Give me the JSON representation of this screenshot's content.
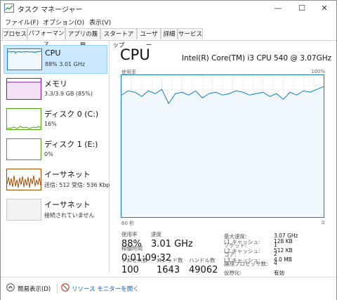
{
  "window": {
    "title": "タスク マネージャー",
    "minimize": "—",
    "maximize": "☐",
    "close": "✕"
  },
  "menu": [
    "ファイル(F)",
    "オプション(O)",
    "表示(V)"
  ],
  "tabs": [
    "プロセス",
    "パフォーマンス",
    "アプリの履歴",
    "スタートアップ",
    "ユーザー",
    "詳細",
    "サービス"
  ],
  "active_tab": 1,
  "resources": [
    {
      "name": "CPU",
      "detail": "88% 3.01 GHz",
      "color": "#117dbb",
      "level": 0.88
    },
    {
      "name": "メモリ",
      "detail": "3.3/3.9 GB (85%)",
      "color": "#8b12ae",
      "level": 0.85
    },
    {
      "name": "ディスク 0 (C:)",
      "detail": "16%",
      "color": "#4da60c",
      "level": 0.16
    },
    {
      "name": "ディスク 1 (E:)",
      "detail": "0%",
      "color": "#4da60c",
      "level": 0.0
    },
    {
      "name": "イーサネット",
      "detail": "送信: 512 受信: 536 Kbp",
      "color": "#a74f01",
      "level": 0.5
    },
    {
      "name": "イーサネット",
      "detail": "接続されていません",
      "color": "#a0a0a0",
      "level": 0.0
    }
  ],
  "cpu": {
    "title": "CPU",
    "model": "Intel(R) Core(TM) i3 CPU 540 @ 3.07GHz",
    "graph_label": "使用率",
    "graph_max": "100%",
    "time_left": "60 秒",
    "time_right": "0",
    "stats": {
      "usage_label": "使用率",
      "usage_value": "88%",
      "speed_label": "速度",
      "speed_value": "3.01 GHz",
      "process_label": "プロセス数",
      "process_value": "100",
      "thread_label": "スレッド数",
      "thread_value": "1643",
      "handle_label": "ハンドル数",
      "handle_value": "49062",
      "uptime_label": "稼働時間",
      "uptime_value": "0:01:09:32"
    },
    "specs": [
      {
        "label": "最大速度:",
        "value": "3.07 GHz"
      },
      {
        "label": "ソケット:",
        "value": "1"
      },
      {
        "label": "コア:",
        "value": "2"
      },
      {
        "label": "論理プロセッサ数:",
        "value": "4"
      },
      {
        "label": "仮想化:",
        "value": "有効"
      },
      {
        "label": "L1 キャッシュ:",
        "value": "128 KB"
      },
      {
        "label": "L2 キャッシュ:",
        "value": "512 KB"
      },
      {
        "label": "L3 キャッシュ:",
        "value": "4.0 MB"
      }
    ]
  },
  "chart_data": {
    "type": "line",
    "x": [
      60,
      58,
      56,
      54,
      52,
      50,
      48,
      46,
      44,
      42,
      40,
      38,
      36,
      34,
      32,
      30,
      28,
      26,
      24,
      22,
      20,
      18,
      16,
      14,
      12,
      10,
      8,
      6,
      4,
      2,
      0
    ],
    "values": [
      86,
      89,
      88,
      85,
      89,
      87,
      90,
      80,
      87,
      88,
      86,
      89,
      84,
      87,
      88,
      86,
      87,
      89,
      88,
      86,
      87,
      88,
      85,
      87,
      83,
      88,
      86,
      89,
      88,
      90,
      92
    ],
    "ylim": [
      0,
      100
    ]
  },
  "footer": {
    "fewer_details": "簡易表示(D)",
    "resource_monitor": "リソース モニターを開く"
  }
}
